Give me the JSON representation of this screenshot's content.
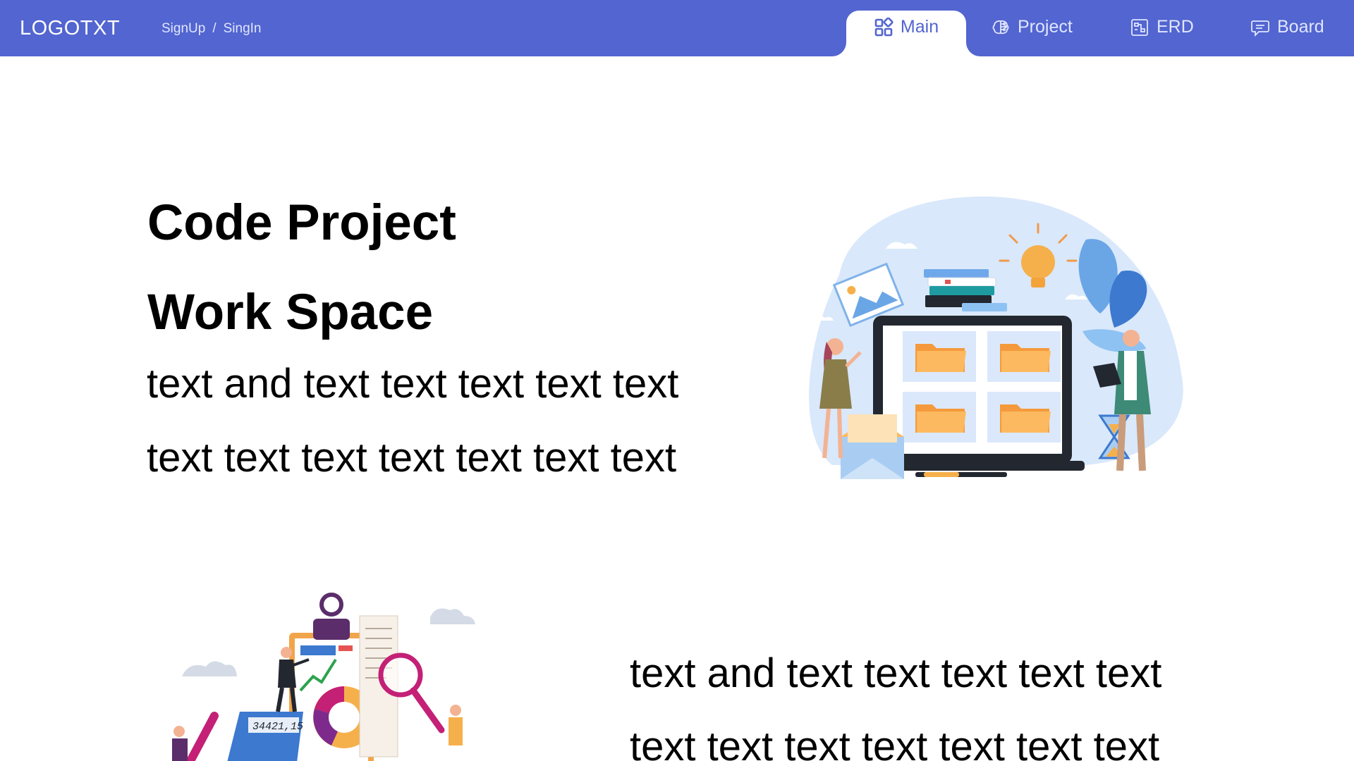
{
  "header": {
    "logo": "LOGOTXT",
    "auth": {
      "signup": "SignUp",
      "separator": "/",
      "signin": "SingIn"
    },
    "tabs": [
      {
        "label": "Main",
        "icon": "grid-icon",
        "active": true
      },
      {
        "label": "Project",
        "icon": "brain-icon",
        "active": false
      },
      {
        "label": "ERD",
        "icon": "diagram-icon",
        "active": false
      },
      {
        "label": "Board",
        "icon": "chat-icon",
        "active": false
      }
    ],
    "colors": {
      "bar": "#5265d0",
      "active_tab_bg": "#ffffff",
      "active_tab_text": "#5265d0",
      "inactive_tab_text": "#e1e6ff"
    }
  },
  "hero": {
    "title_line1": "Code Project",
    "title_line2": "Work Space",
    "text_line1": "text and text text text text text",
    "text_line2": "text text text text text text text"
  },
  "section2": {
    "text_line1": "text and text text text text text",
    "text_line2": "text text text text text text text",
    "calculator_display": "34421,15"
  }
}
